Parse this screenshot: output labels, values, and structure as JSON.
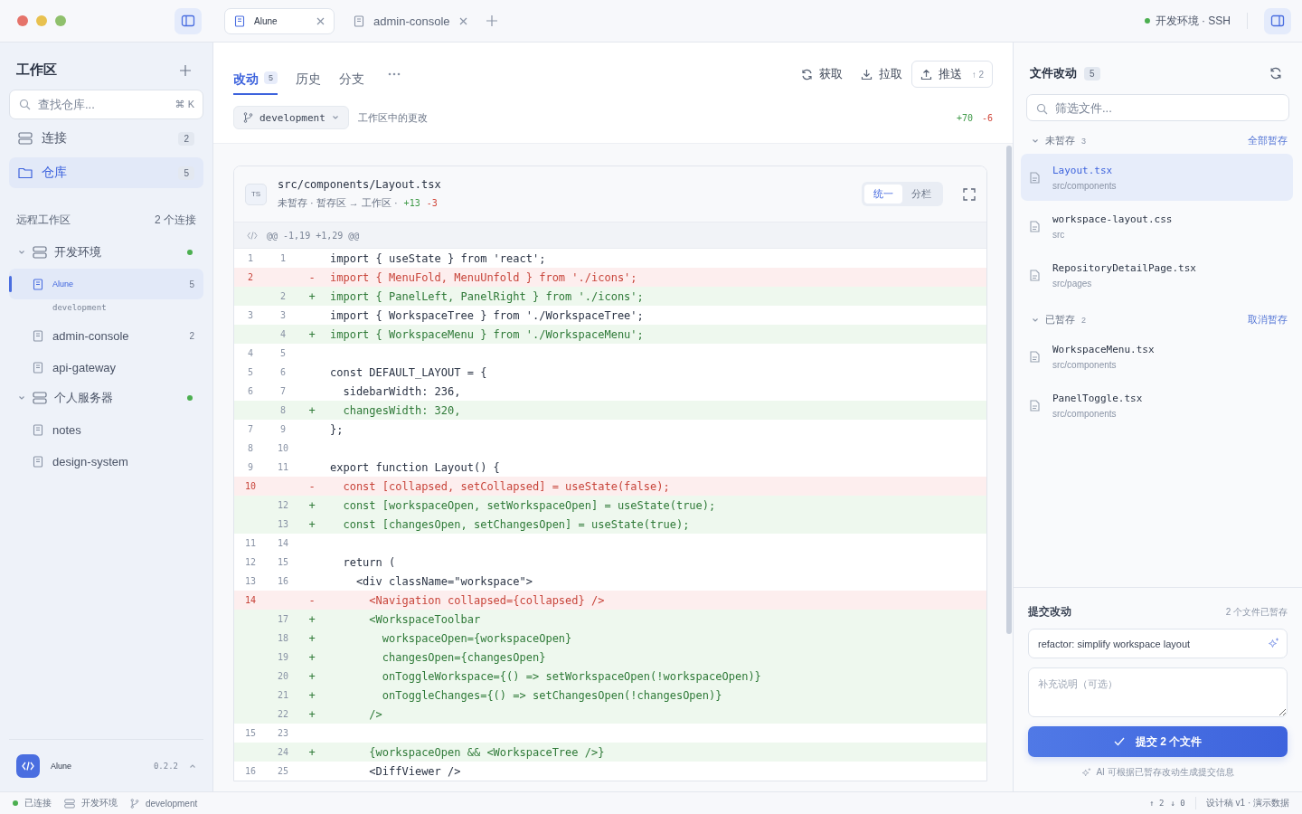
{
  "titlebar": {
    "tabs": [
      {
        "label": "Alune",
        "selected": true
      },
      {
        "label": "admin-console",
        "selected": false
      }
    ],
    "connection": {
      "label": "开发环境 · SSH",
      "online": true
    }
  },
  "sidebar": {
    "title": "工作区",
    "search": {
      "placeholder": "查找仓库...",
      "shortcut": "⌘ K"
    },
    "nav": [
      {
        "label": "连接",
        "count": "2",
        "kind": "server",
        "selected": false
      },
      {
        "label": "仓库",
        "count": "5",
        "kind": "folder",
        "selected": true
      }
    ],
    "section": {
      "label": "远程工作区",
      "count": "2 个连接"
    },
    "servers": [
      {
        "name": "开发环境",
        "expanded": true,
        "online": true,
        "children": [
          {
            "name": "Alune",
            "branch": "development",
            "count": "5",
            "selected": true
          },
          {
            "name": "admin-console",
            "count": "2",
            "selected": false
          },
          {
            "name": "api-gateway",
            "selected": false
          }
        ]
      },
      {
        "name": "个人服务器",
        "expanded": true,
        "online": true,
        "children": [
          {
            "name": "notes",
            "selected": false
          },
          {
            "name": "design-system",
            "selected": false
          }
        ]
      }
    ],
    "footer": {
      "app": "Alune",
      "version": "0.2.2"
    }
  },
  "main": {
    "tabs": [
      {
        "label": "改动",
        "count": "5",
        "selected": true
      },
      {
        "label": "历史",
        "selected": false
      },
      {
        "label": "分支",
        "selected": false
      }
    ],
    "actions": [
      {
        "label": "获取",
        "kind": "fetch"
      },
      {
        "label": "拉取",
        "kind": "pull"
      },
      {
        "label": "推送",
        "kind": "push",
        "count": "↑ 2"
      }
    ],
    "branch": "development",
    "scope": "工作区中的更改",
    "added": "+70",
    "removed": "-6",
    "file": {
      "badge": "TS",
      "path": "src/components/Layout.tsx",
      "meta": "未暂存 · 暂存区 → 工作区 ·",
      "added": "+13",
      "removed": "-3",
      "views": [
        {
          "label": "统一",
          "selected": true
        },
        {
          "label": "分栏",
          "selected": false
        }
      ],
      "hunk": "@@ -1,19 +1,29 @@",
      "lines": [
        {
          "kind": "ctx",
          "old": "1",
          "new": "1",
          "code": "import { useState } from 'react';"
        },
        {
          "kind": "del",
          "old": "2",
          "sign": "-",
          "code": "import { MenuFold, MenuUnfold } from './icons';"
        },
        {
          "kind": "add",
          "new": "2",
          "sign": "+",
          "code": "import { PanelLeft, PanelRight } from './icons';"
        },
        {
          "kind": "ctx",
          "old": "3",
          "new": "3",
          "code": "import { WorkspaceTree } from './WorkspaceTree';"
        },
        {
          "kind": "add",
          "new": "4",
          "sign": "+",
          "code": "import { WorkspaceMenu } from './WorkspaceMenu';"
        },
        {
          "kind": "ctx",
          "old": "4",
          "new": "5"
        },
        {
          "kind": "ctx",
          "old": "5",
          "new": "6",
          "code": "const DEFAULT_LAYOUT = {"
        },
        {
          "kind": "ctx",
          "old": "6",
          "new": "7",
          "code": "  sidebarWidth: 236,"
        },
        {
          "kind": "add",
          "new": "8",
          "sign": "+",
          "code": "  changesWidth: 320,"
        },
        {
          "kind": "ctx",
          "old": "7",
          "new": "9",
          "code": "};"
        },
        {
          "kind": "ctx",
          "old": "8",
          "new": "10"
        },
        {
          "kind": "ctx",
          "old": "9",
          "new": "11",
          "code": "export function Layout() {"
        },
        {
          "kind": "del",
          "old": "10",
          "sign": "-",
          "code": "  const [collapsed, setCollapsed] = useState(false);"
        },
        {
          "kind": "add",
          "new": "12",
          "sign": "+",
          "code": "  const [workspaceOpen, setWorkspaceOpen] = useState(true);"
        },
        {
          "kind": "add",
          "new": "13",
          "sign": "+",
          "code": "  const [changesOpen, setChangesOpen] = useState(true);"
        },
        {
          "kind": "ctx",
          "old": "11",
          "new": "14"
        },
        {
          "kind": "ctx",
          "old": "12",
          "new": "15",
          "code": "  return ("
        },
        {
          "kind": "ctx",
          "old": "13",
          "new": "16",
          "code": "    <div className=\"workspace\">"
        },
        {
          "kind": "del",
          "old": "14",
          "sign": "-",
          "code": "      <Navigation collapsed={collapsed} />"
        },
        {
          "kind": "add",
          "new": "17",
          "sign": "+",
          "code": "      <WorkspaceToolbar"
        },
        {
          "kind": "add",
          "new": "18",
          "sign": "+",
          "code": "        workspaceOpen={workspaceOpen}"
        },
        {
          "kind": "add",
          "new": "19",
          "sign": "+",
          "code": "        changesOpen={changesOpen}"
        },
        {
          "kind": "add",
          "new": "20",
          "sign": "+",
          "code": "        onToggleWorkspace={() => setWorkspaceOpen(!workspaceOpen)}"
        },
        {
          "kind": "add",
          "new": "21",
          "sign": "+",
          "code": "        onToggleChanges={() => setChangesOpen(!changesOpen)}"
        },
        {
          "kind": "add",
          "new": "22",
          "sign": "+",
          "code": "      />"
        },
        {
          "kind": "ctx",
          "old": "15",
          "new": "23"
        },
        {
          "kind": "add",
          "new": "24",
          "sign": "+",
          "code": "      {workspaceOpen && <WorkspaceTree />}"
        },
        {
          "kind": "ctx",
          "old": "16",
          "new": "25",
          "code": "      <DiffViewer />"
        }
      ]
    }
  },
  "changes": {
    "title": "文件改动",
    "count": "5",
    "filter": {
      "placeholder": "筛选文件..."
    },
    "groups": [
      {
        "label": "未暂存",
        "count": "3",
        "action": "全部暂存",
        "expanded": true,
        "files": [
          {
            "name": "Layout.tsx",
            "dir": "src/components",
            "selected": true
          },
          {
            "name": "workspace-layout.css",
            "dir": "src",
            "selected": false
          },
          {
            "name": "RepositoryDetailPage.tsx",
            "dir": "src/pages",
            "selected": false
          }
        ]
      },
      {
        "label": "已暂存",
        "count": "2",
        "action": "取消暂存",
        "expanded": true,
        "files": [
          {
            "name": "WorkspaceMenu.tsx",
            "dir": "src/components",
            "selected": false
          },
          {
            "name": "PanelToggle.tsx",
            "dir": "src/components",
            "selected": false
          }
        ]
      }
    ],
    "commit": {
      "title": "提交改动",
      "meta": "2 个文件已暂存",
      "summary": "refactor: simplify workspace layout",
      "description_placeholder": "补充说明（可选）",
      "button": "提交 2 个文件",
      "hint": "AI 可根据已暂存改动生成提交信息"
    }
  },
  "status_bar": {
    "connected": "已连接",
    "server": "开发环境",
    "branch": "development",
    "ahead": "↑ 2",
    "behind": "↓ 0",
    "note": "设计稿 v1 · 演示数据"
  }
}
